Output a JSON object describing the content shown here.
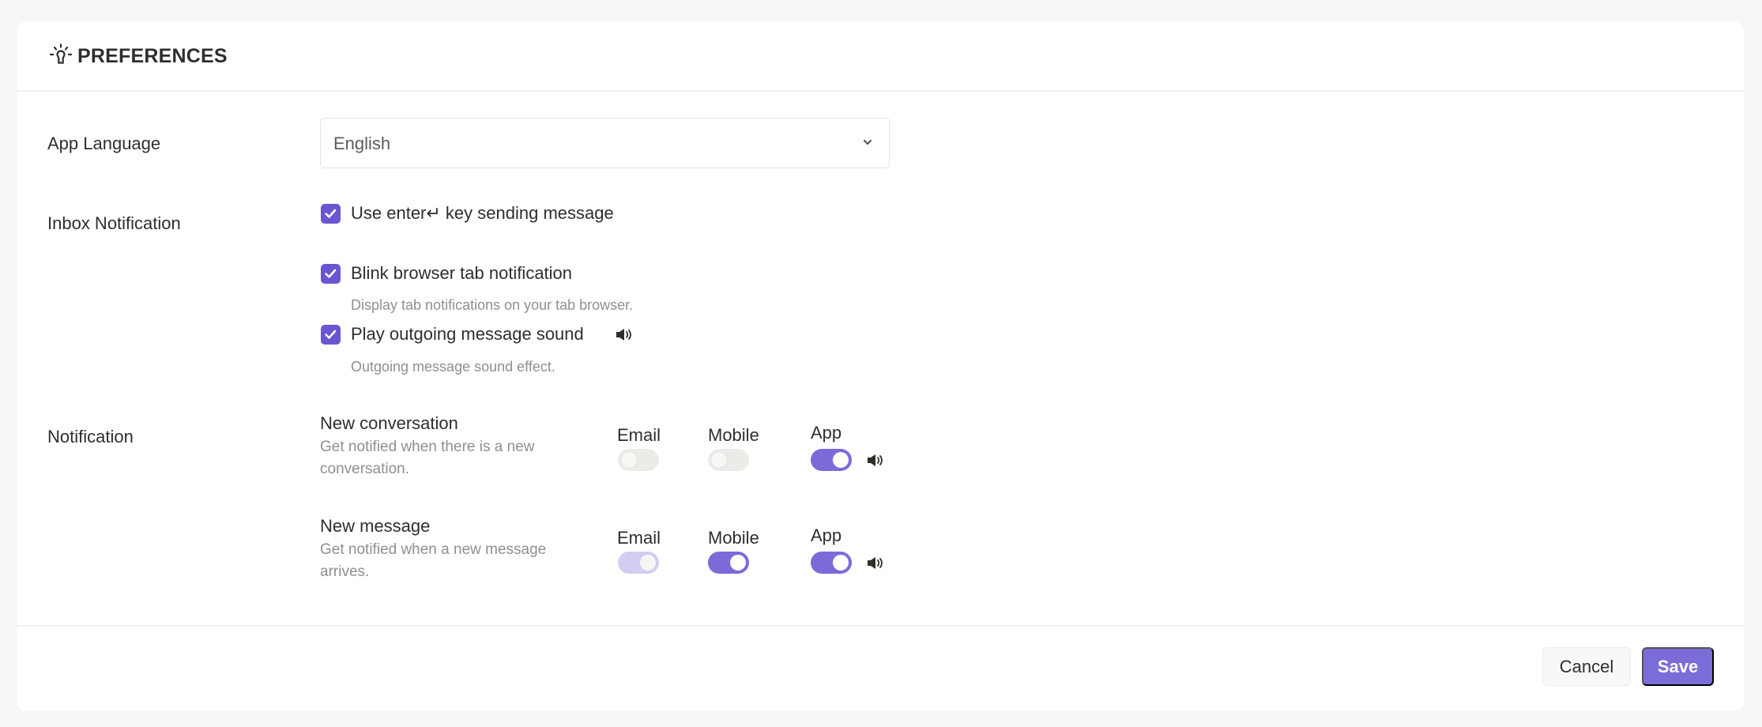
{
  "header": {
    "icon": "lightbulb-icon",
    "title": "PREFERENCES"
  },
  "app_language": {
    "label": "App Language",
    "selected": "English",
    "chevron_icon": "chevron-down-icon"
  },
  "inbox_notification": {
    "label": "Inbox Notification",
    "options": [
      {
        "label": "Use enter↵ key sending message",
        "checked": true,
        "description": ""
      },
      {
        "label": "Blink browser tab notification",
        "checked": true,
        "description": "Display tab notifications on your tab browser."
      },
      {
        "label": "Play outgoing message sound",
        "checked": true,
        "description": "Outgoing message sound effect.",
        "icon": "speaker-icon"
      }
    ]
  },
  "notification": {
    "label": "Notification",
    "columns": [
      "Email",
      "Mobile",
      "App"
    ],
    "rows": [
      {
        "title": "New conversation",
        "description": "Get notified when there is a new conversation.",
        "email": {
          "on": false,
          "disabled": false
        },
        "mobile": {
          "on": false,
          "disabled": false
        },
        "app": {
          "on": true,
          "disabled": false
        }
      },
      {
        "title": "New message",
        "description": "Get notified when a new message arrives.",
        "email": {
          "on": true,
          "disabled": true
        },
        "mobile": {
          "on": true,
          "disabled": false
        },
        "app": {
          "on": true,
          "disabled": false
        }
      }
    ]
  },
  "footer": {
    "cancel_label": "Cancel",
    "save_label": "Save"
  },
  "colors": {
    "accent": "#7b6dd8",
    "checkbox": "#6a55d3",
    "toggle_off": "#ebebe7",
    "toggle_disabled_on": "#d4cdf1",
    "background": "#f7f7f5"
  }
}
